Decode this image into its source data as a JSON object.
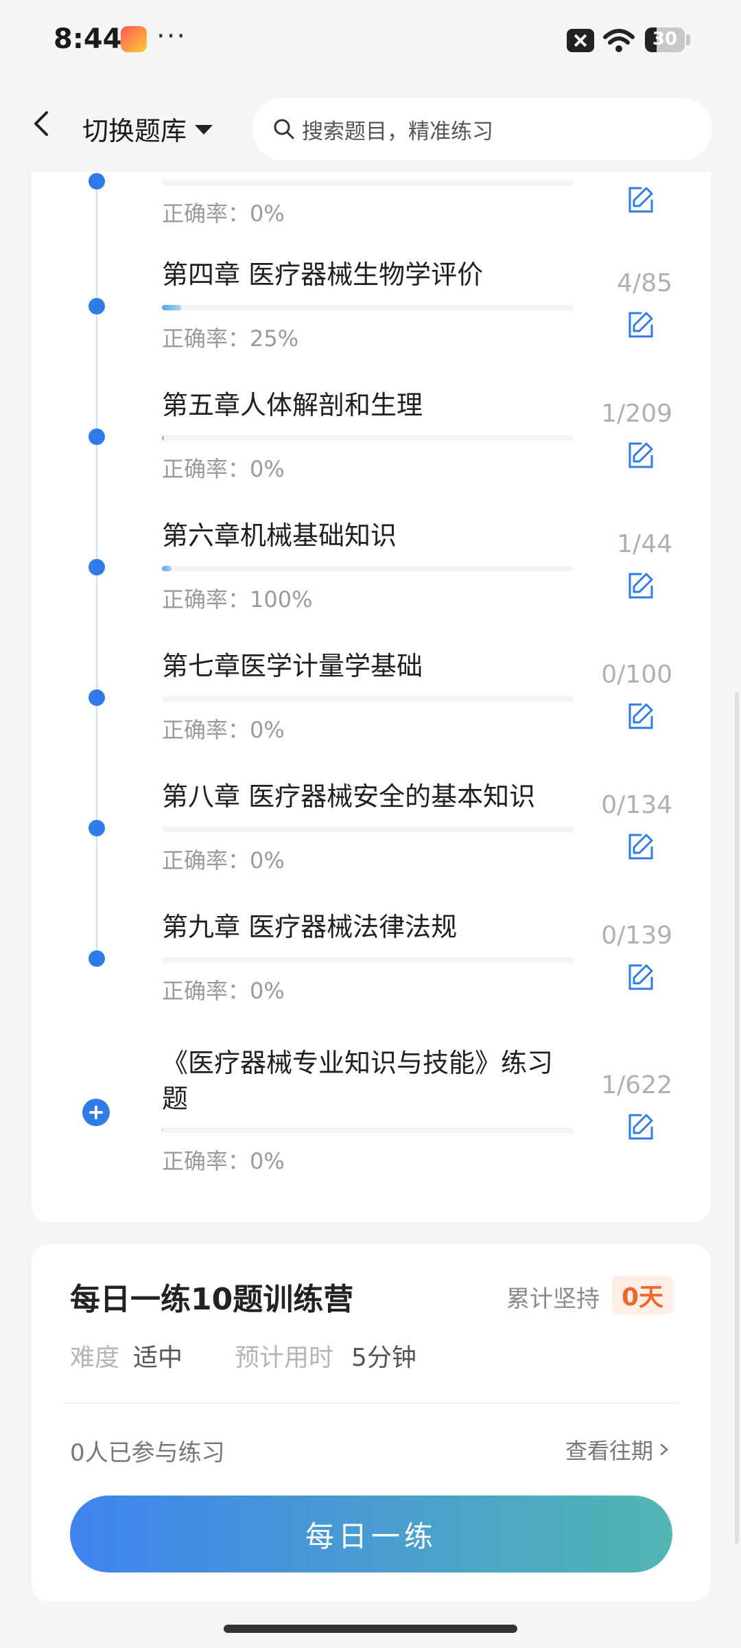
{
  "status_bar": {
    "time": "8:44",
    "dots": "···",
    "battery": "30"
  },
  "header": {
    "switch_label": "切换题库",
    "search_placeholder": "搜索题目，精准练习"
  },
  "chapters": [
    {
      "title": "",
      "rate": "正确率：0%",
      "count": "",
      "progress": 0
    },
    {
      "title": "第四章 医疗器械生物学评价",
      "rate": "正确率：25%",
      "count": "4/85",
      "progress": 0.047
    },
    {
      "title": "第五章人体解剖和生理",
      "rate": "正确率：0%",
      "count": "1/209",
      "progress": 0.005
    },
    {
      "title": "第六章机械基础知识",
      "rate": "正确率：100%",
      "count": "1/44",
      "progress": 0.023
    },
    {
      "title": "第七章医学计量学基础",
      "rate": "正确率：0%",
      "count": "0/100",
      "progress": 0
    },
    {
      "title": "第八章 医疗器械安全的基本知识",
      "rate": "正确率：0%",
      "count": "0/134",
      "progress": 0
    },
    {
      "title": "第九章 医疗器械法律法规",
      "rate": "正确率：0%",
      "count": "0/139",
      "progress": 0
    },
    {
      "title": "《医疗器械专业知识与技能》练习题",
      "rate": "正确率：0%",
      "count": "1/622",
      "progress": 0.002
    }
  ],
  "camp": {
    "title": "每日一练10题训练营",
    "persist_label": "累计坚持",
    "persist_days": "0天",
    "difficulty_label": "难度",
    "difficulty_value": "适中",
    "time_label": "预计用时",
    "time_value": "5分钟",
    "participants": "0人已参与练习",
    "history_link": "查看往期",
    "button": "每日一练"
  },
  "colors": {
    "accent": "#2f7ce8",
    "badge": "#f0672e"
  }
}
